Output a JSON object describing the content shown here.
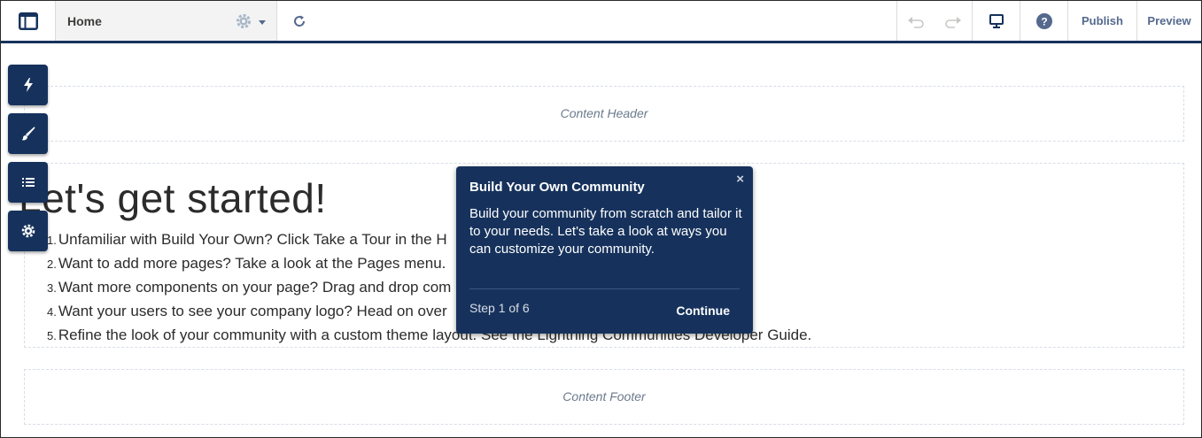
{
  "topbar": {
    "page_label": "Home",
    "publish_label": "Publish",
    "preview_label": "Preview"
  },
  "regions": {
    "header_label": "Content Header",
    "footer_label": "Content Footer"
  },
  "main": {
    "title": "Let's get started!",
    "steps": [
      {
        "num": "1.",
        "text": "Unfamiliar with Build Your Own? Click Take a Tour in the H"
      },
      {
        "num": "2.",
        "text": "Want to add more pages? Take a look at the Pages menu."
      },
      {
        "num": "3.",
        "text": "Want more components on your page? Drag and drop com"
      },
      {
        "num": "4.",
        "text": "Want your users to see your company logo? Head on over"
      },
      {
        "num": "5.",
        "text": "Refine the look of your community with a custom theme layout. See the Lightning Communities Developer Guide."
      }
    ]
  },
  "popover": {
    "close": "×",
    "title": "Build Your Own Community",
    "body": "Build your community from scratch and tailor it to your needs. Let's take a look at ways you can customize your community.",
    "step": "Step 1 of 6",
    "continue_label": "Continue"
  },
  "icons": {
    "logo": "layout-icon",
    "page_settings": "gear-icon",
    "refresh": "refresh-icon",
    "undo": "undo-icon",
    "redo": "redo-icon",
    "device": "desktop-icon",
    "help": "help-icon",
    "components": "lightning-bolt-icon",
    "theme": "paintbrush-icon",
    "pages": "list-icon",
    "settings": "settings-icon"
  },
  "colors": {
    "navy": "#16325c",
    "grey_icon": "#54698d"
  }
}
